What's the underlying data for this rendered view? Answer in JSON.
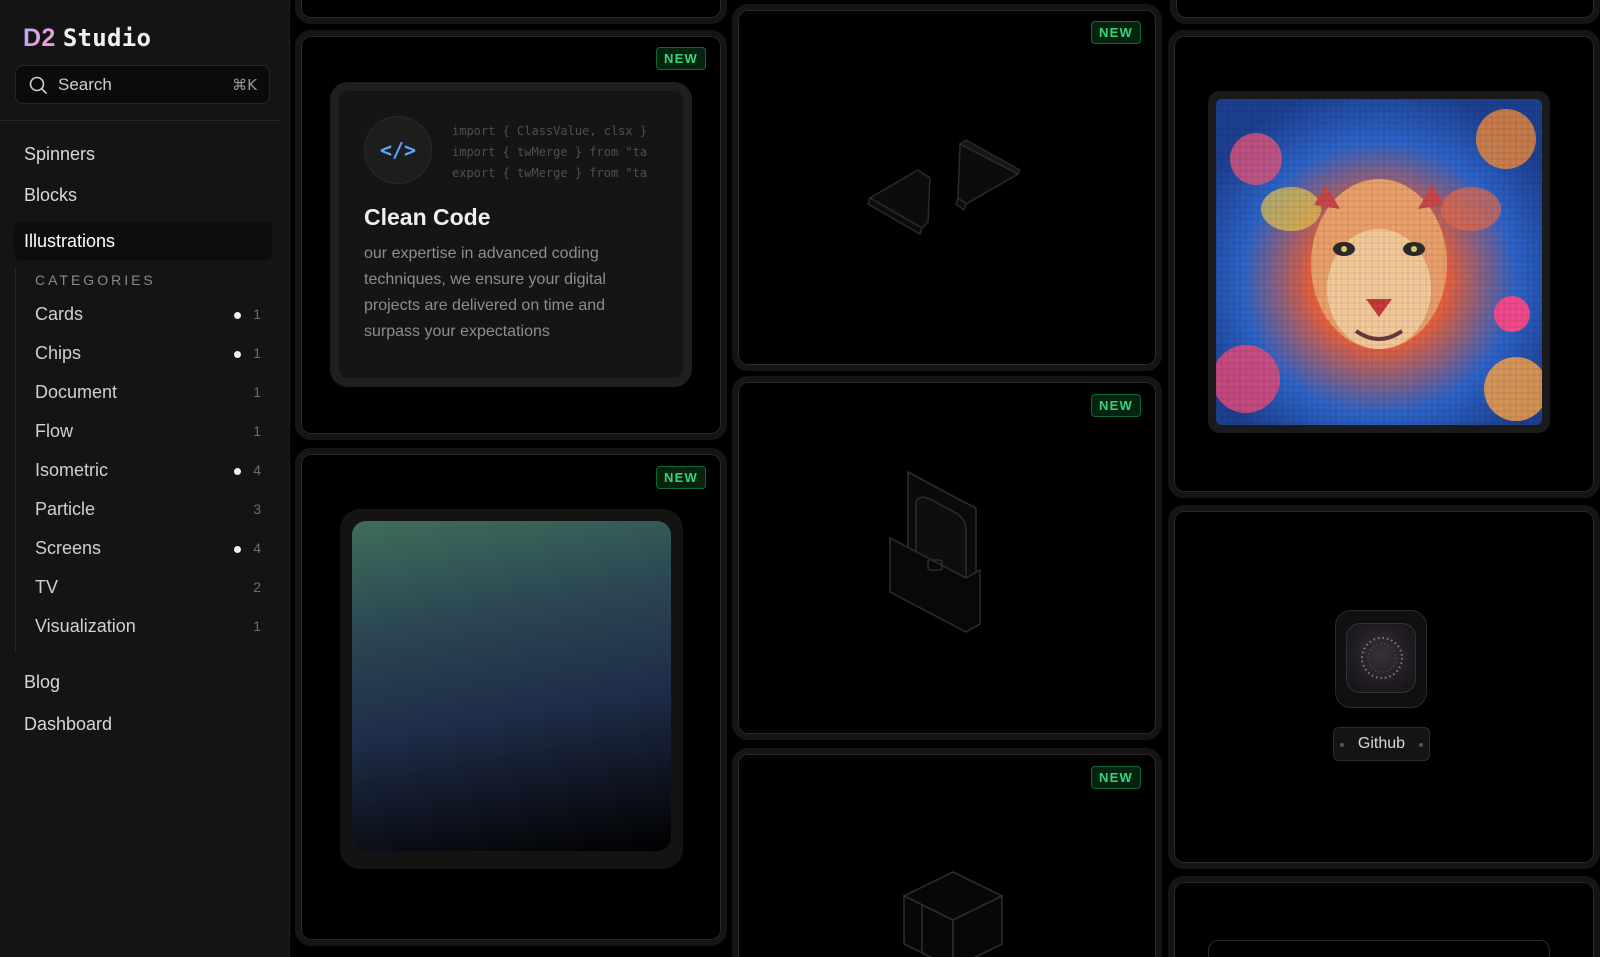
{
  "app": {
    "logo_prefix": "D2",
    "logo_suffix": "Studio"
  },
  "search": {
    "placeholder": "Search",
    "shortcut": "⌘K"
  },
  "nav": {
    "top": [
      {
        "label": "Spinners"
      },
      {
        "label": "Blocks"
      },
      {
        "label": "Illustrations"
      }
    ],
    "bottom": [
      {
        "label": "Blog"
      },
      {
        "label": "Dashboard"
      }
    ]
  },
  "categories": {
    "header": "CATEGORIES",
    "items": [
      {
        "label": "Cards",
        "count": "1",
        "new": true
      },
      {
        "label": "Chips",
        "count": "1",
        "new": true
      },
      {
        "label": "Document",
        "count": "1",
        "new": false
      },
      {
        "label": "Flow",
        "count": "1",
        "new": false
      },
      {
        "label": "Isometric",
        "count": "4",
        "new": true
      },
      {
        "label": "Particle",
        "count": "3",
        "new": false
      },
      {
        "label": "Screens",
        "count": "4",
        "new": true
      },
      {
        "label": "TV",
        "count": "2",
        "new": false
      },
      {
        "label": "Visualization",
        "count": "1",
        "new": false
      }
    ]
  },
  "badge_label": "NEW",
  "code_card": {
    "code_lines": [
      "import { ClassValue, clsx }",
      "import { twMerge } from \"ta",
      "export { twMerge } from \"ta"
    ],
    "title": "Clean Code",
    "description": "our expertise in advanced coding techniques, we ensure your digital projects are delivered on time and surpass your expectations"
  },
  "github_card": {
    "button_label": "Github"
  },
  "colors": {
    "accent_new": "#38d27a",
    "background": "#000000",
    "sidebar": "#141414"
  }
}
